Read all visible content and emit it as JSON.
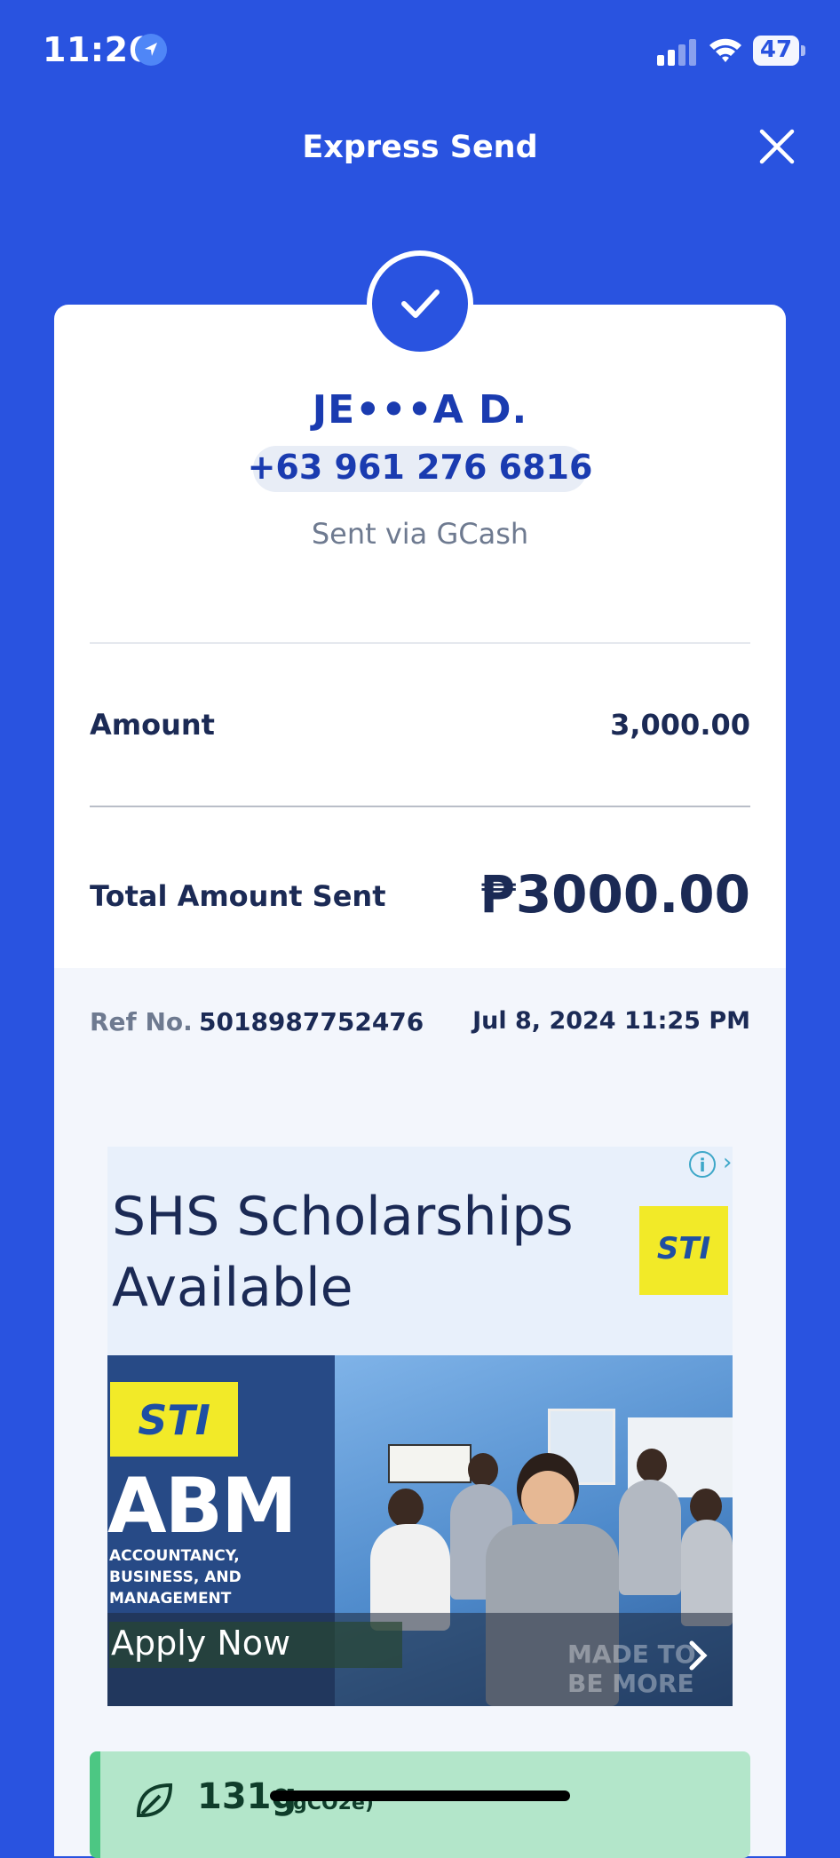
{
  "status_bar": {
    "time": "11:26",
    "battery": "47"
  },
  "header": {
    "title": "Express Send"
  },
  "receipt": {
    "recipient_name": "JE•••A D.",
    "phone": "+63 961 276 6816",
    "sent_via": "Sent via GCash",
    "amount_label": "Amount",
    "amount_value": "3,000.00",
    "total_label": "Total Amount Sent",
    "total_value": "₱3000.00",
    "ref_label": "Ref No.",
    "ref_number": "5018987752476",
    "datetime": "Jul 8, 2024 11:25 PM"
  },
  "ad": {
    "headline": "SHS Scholarships Available",
    "logo": "STI",
    "strand": "ABM",
    "strand_desc": "ACCOUNTANCY, BUSINESS, AND MANAGEMENT",
    "cta": "Apply Now",
    "tagline": "MADE TO BE MORE"
  },
  "carbon": {
    "value": "131g",
    "unit": "(gCO2e)"
  },
  "colors": {
    "brand_blue": "#2953E0",
    "text_dark": "#1B2A55",
    "carbon_green": "#B3E6CA"
  }
}
